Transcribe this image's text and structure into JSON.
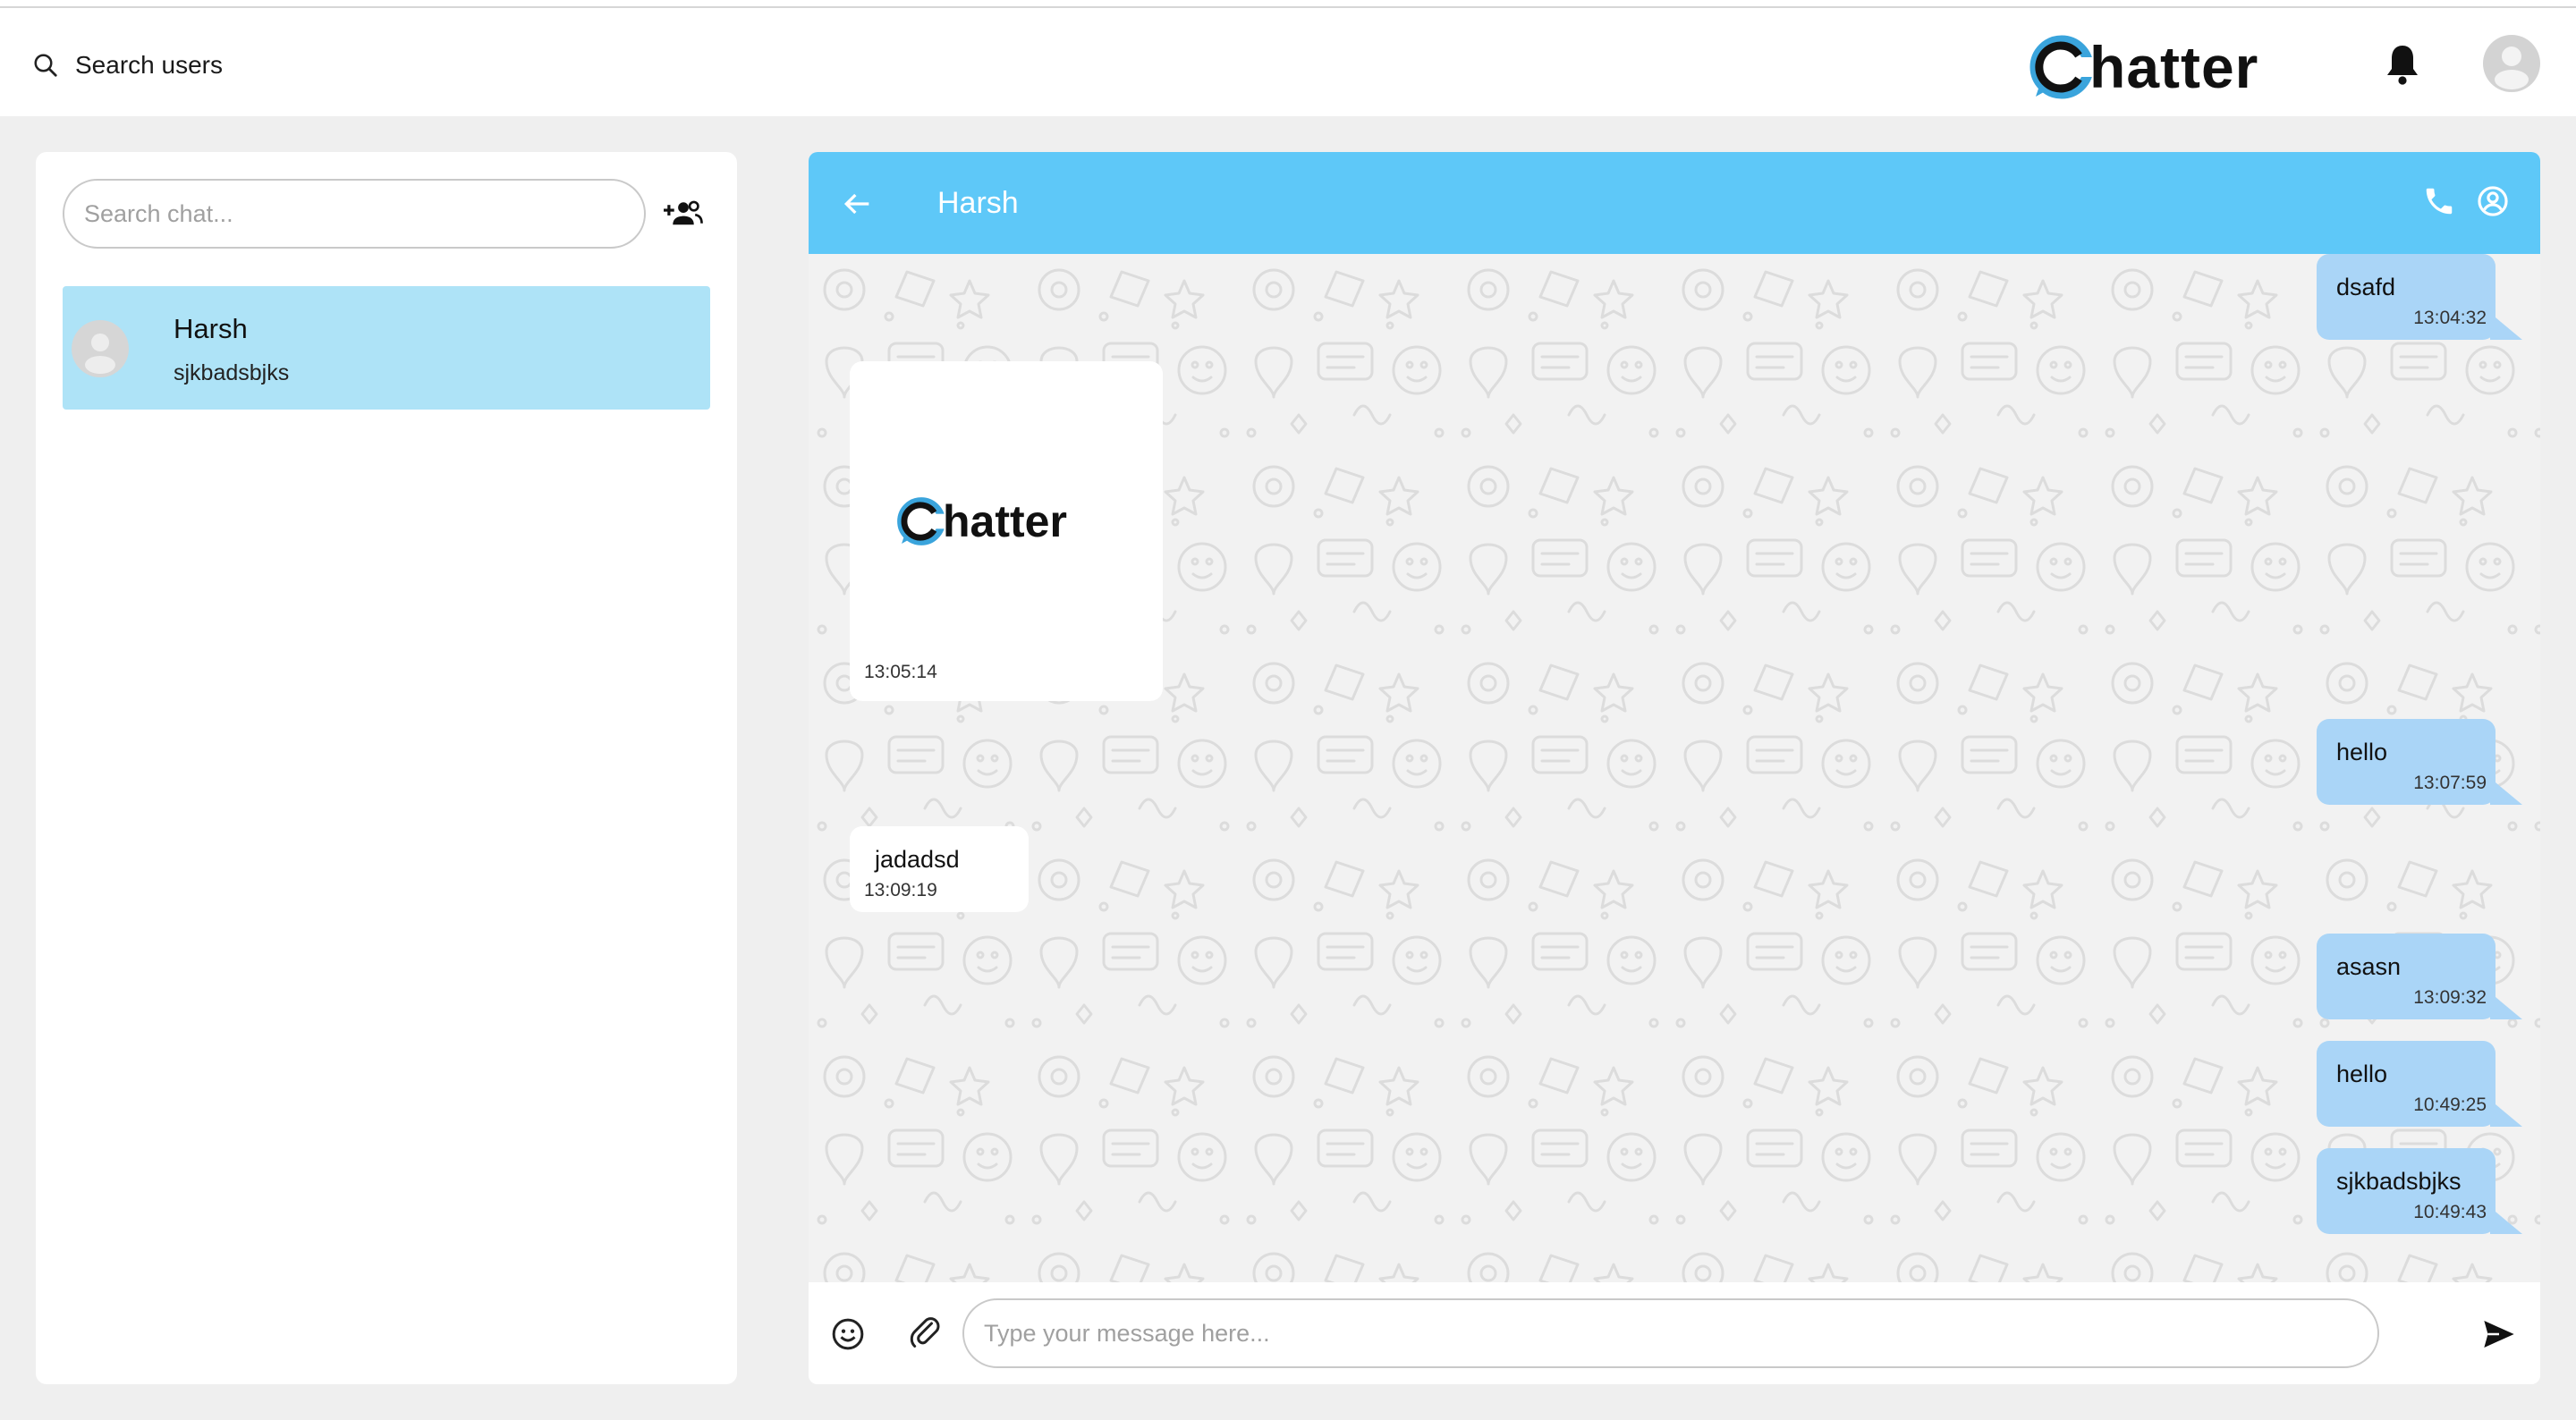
{
  "header": {
    "search_users_label": "Search users",
    "brand_letter": "C",
    "brand_rest": "hatter",
    "icons": {
      "search": "search-icon",
      "bell": "bell-icon",
      "avatar": "user-avatar-icon"
    }
  },
  "sidebar": {
    "search_placeholder": "Search chat...",
    "add_group_icon": "group-add-icon",
    "chats": [
      {
        "name": "Harsh",
        "last_message": "sjkbadsbjks",
        "selected": true
      }
    ]
  },
  "chat": {
    "title": "Harsh",
    "icons": {
      "back": "arrow-left-icon",
      "call": "phone-icon",
      "profile": "account-circle-icon"
    },
    "messages": [
      {
        "direction": "out",
        "text": "dsafd",
        "time": "13:04:32"
      },
      {
        "direction": "in",
        "type": "image",
        "image_brand_letter": "C",
        "image_brand_rest": "hatter",
        "time": "13:05:14"
      },
      {
        "direction": "out",
        "text": "hello",
        "time": "13:07:59"
      },
      {
        "direction": "in",
        "text": "jadadsd",
        "time": "13:09:19"
      },
      {
        "direction": "out",
        "text": "asasn",
        "time": "13:09:32"
      },
      {
        "direction": "out",
        "text": "hello",
        "time": "10:49:25"
      },
      {
        "direction": "out",
        "text": "sjkbadsbjks",
        "time": "10:49:43"
      }
    ],
    "composer": {
      "placeholder": "Type your message here...",
      "icons": {
        "emoji": "emoji-icon",
        "attach": "paperclip-icon",
        "send": "send-icon"
      }
    }
  },
  "colors": {
    "header_bar": "#5ec8f8",
    "selected_chat": "#aee3f7",
    "outgoing_bubble": "#aad5f7",
    "brand_blue": "#3aa4dc"
  }
}
